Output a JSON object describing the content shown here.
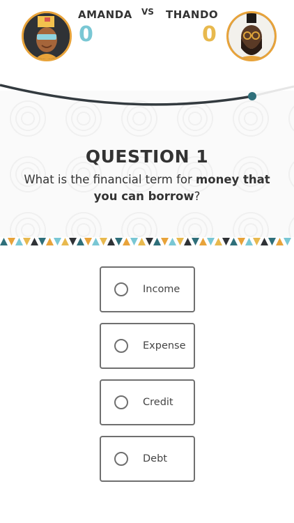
{
  "header": {
    "player1": {
      "name": "AMANDA",
      "score": "0"
    },
    "vs": "VS",
    "player2": {
      "name": "THANDO",
      "score": "0"
    }
  },
  "question": {
    "title": "QUESTION 1",
    "text_prefix": "What is the financial term for ",
    "text_bold": "money that you can borrow",
    "text_suffix": "?"
  },
  "options": [
    "Income",
    "Expense",
    "Credit",
    "Debt"
  ],
  "colors": {
    "player1_score": "#79c7d4",
    "player2_score": "#e8b94e",
    "avatar_border": "#e8a33a",
    "progress_track": "#333a3f",
    "progress_dot": "#2f6f7a"
  },
  "icons": {
    "player1_avatar": "avatar-amanda-icon",
    "player2_avatar": "avatar-thando-icon",
    "radio": "radio-unselected-icon"
  }
}
